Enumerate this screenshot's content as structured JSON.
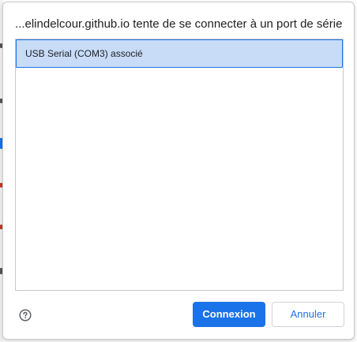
{
  "dialog": {
    "title": "...elindelcour.github.io tente de se connecter à un port de série",
    "ports": [
      {
        "label": "USB Serial (COM3) associé",
        "selected": true
      }
    ],
    "help_icon": "help-circle-icon",
    "connect_label": "Connexion",
    "cancel_label": "Annuler"
  },
  "colors": {
    "accent": "#1a73e8",
    "selected_bg": "#c8dcf8",
    "border": "#c8c8c8"
  }
}
